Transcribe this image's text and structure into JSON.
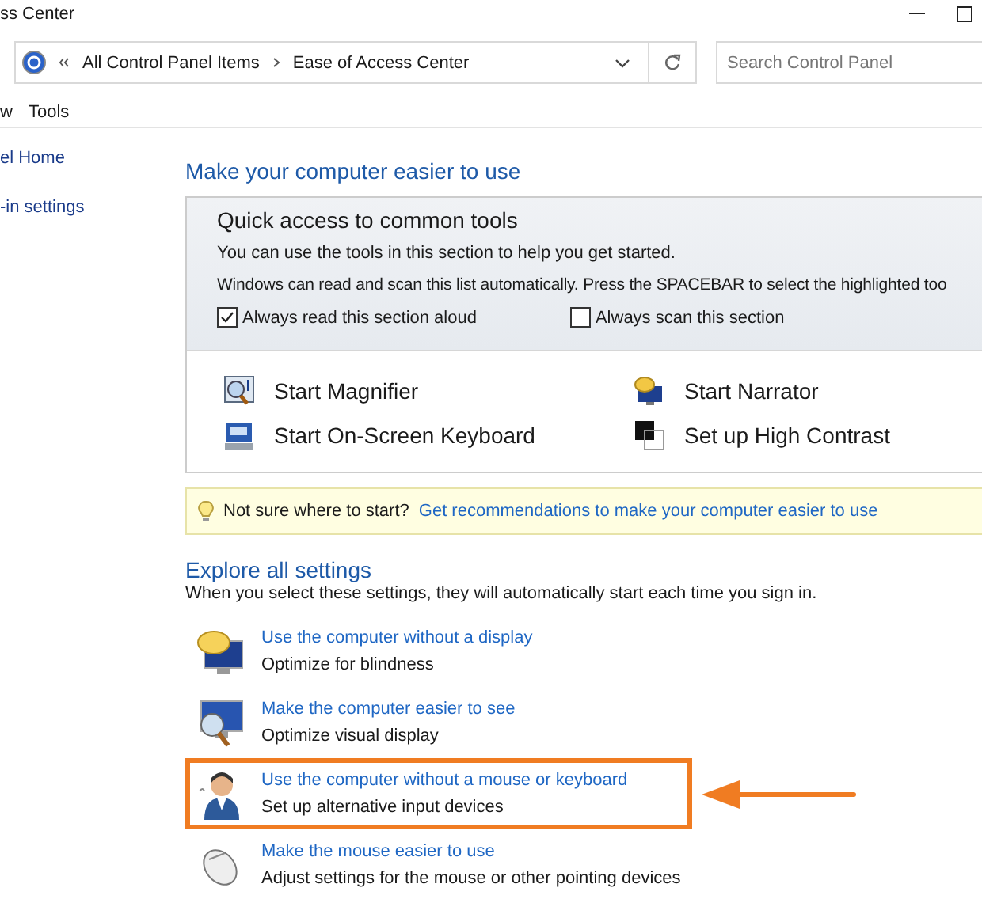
{
  "window": {
    "title": "ss Center"
  },
  "address_bar": {
    "breadcrumbs": [
      "All Control Panel Items",
      "Ease of Access Center"
    ]
  },
  "search": {
    "placeholder": "Search Control Panel"
  },
  "menu": [
    "w",
    "Tools"
  ],
  "sidebar": {
    "items": [
      "el Home",
      "-in settings"
    ]
  },
  "heading": "Make your computer easier to use",
  "quick_access": {
    "title": "Quick access to common tools",
    "lines": [
      "You can use the tools in this section to help you get started.",
      "Windows can read and scan this list automatically.  Press the SPACEBAR to select the highlighted too"
    ],
    "checkboxes": [
      {
        "label": "Always read this section aloud",
        "checked": true
      },
      {
        "label": "Always scan this section",
        "checked": false
      }
    ],
    "tools": [
      {
        "label": "Start Magnifier",
        "kind": "magnifier"
      },
      {
        "label": "Start Narrator",
        "kind": "narrator"
      },
      {
        "label": "Start On-Screen Keyboard",
        "kind": "keyboard"
      },
      {
        "label": "Set up High Contrast",
        "kind": "contrast"
      }
    ]
  },
  "tip": {
    "text": "Not sure where to start?",
    "link": "Get recommendations to make your computer easier to use"
  },
  "explore": {
    "title": "Explore all settings",
    "description": "When you select these settings, they will automatically start each time you sign in.",
    "items": [
      {
        "link": "Use the computer without a display",
        "description": "Optimize for blindness",
        "kind": "display",
        "highlighted": false
      },
      {
        "link": "Make the computer easier to see",
        "description": "Optimize visual display",
        "kind": "see",
        "highlighted": false
      },
      {
        "link": "Use the computer without a mouse or keyboard",
        "description": "Set up alternative input devices",
        "kind": "person",
        "highlighted": true
      },
      {
        "link": "Make the mouse easier to use",
        "description": "Adjust settings for the mouse or other pointing devices",
        "kind": "mouse",
        "highlighted": false
      }
    ]
  }
}
